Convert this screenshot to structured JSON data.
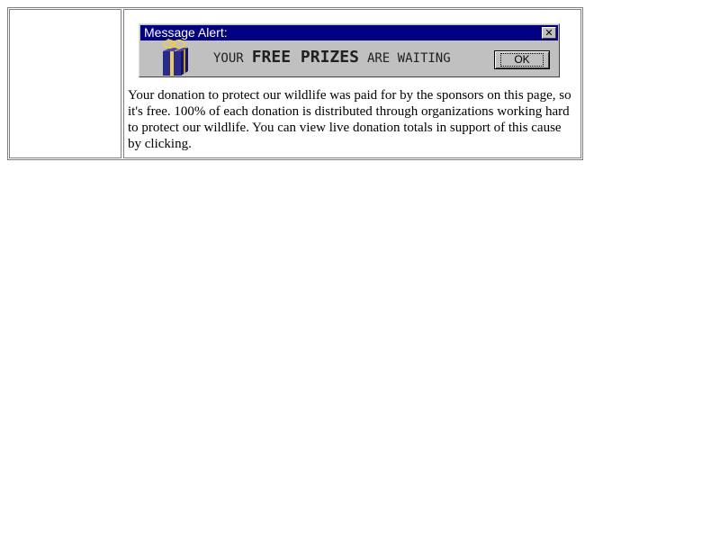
{
  "banner": {
    "title": "Message Alert:",
    "close_glyph": "✕",
    "icon": "gift-box-icon",
    "message_prefix": "YOUR",
    "message_highlight": "FREE PRIZES",
    "message_suffix": "ARE WAITING",
    "ok_label": "OK"
  },
  "content": {
    "paragraph": "Your donation to protect our wildlife was paid for by the sponsors on this page, so it's free. 100% of each donation is distributed through organizations working hard to protect our wildlife. You can view live donation totals in support of this cause by clicking."
  },
  "colors": {
    "titlebar": "#000080",
    "dialog_face": "#c0c0c0",
    "gift_box": "#2a2a8a",
    "ribbon": "#e8c860"
  }
}
